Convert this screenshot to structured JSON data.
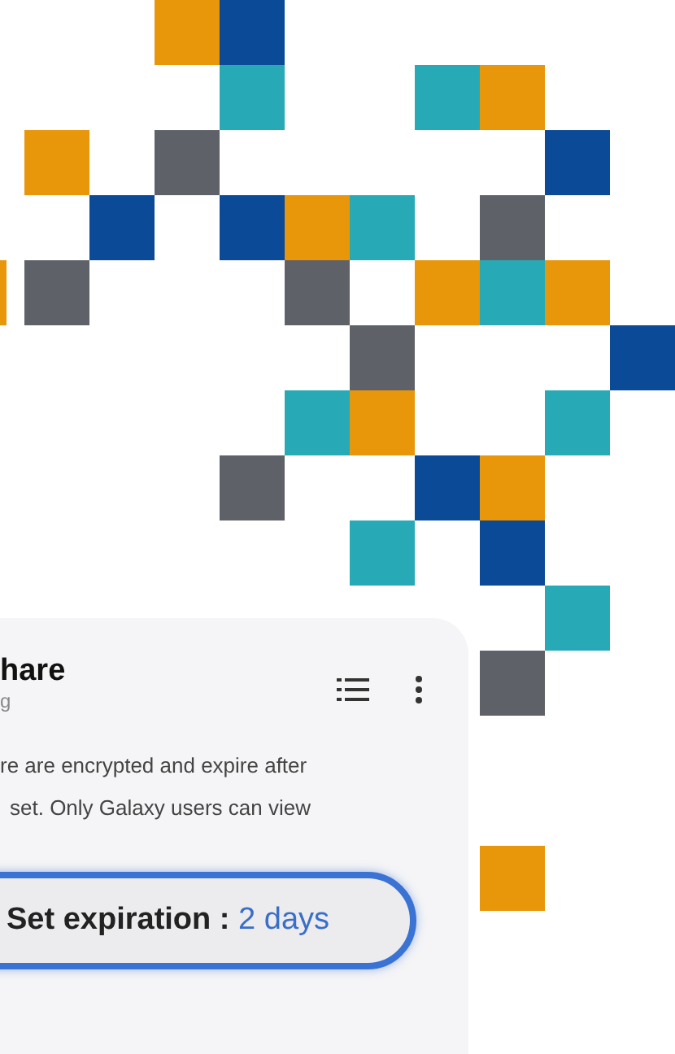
{
  "card": {
    "title": "hare",
    "subtitle": "g",
    "description_lines": [
      "re are encrypted and expire after",
      "set. Only Galaxy users can view"
    ],
    "expiration_button": {
      "label": "Set expiration :",
      "value": "2 days"
    }
  }
}
